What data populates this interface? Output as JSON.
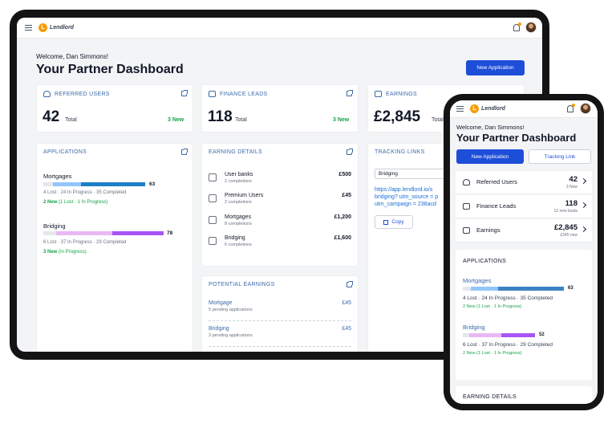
{
  "brand": {
    "name": "Lendlord",
    "logo_letter": "L"
  },
  "colors": {
    "accent": "#1d4ed8",
    "link": "#3b6aa8",
    "green": "#16a34a",
    "logo": "#f59e0b",
    "bar_light": "#93c5fd",
    "bar_dark": "#1e7fc6",
    "bar_purple_light": "#e9b8f5",
    "bar_purple_dark": "#a855f7"
  },
  "header": {
    "welcome": "Welcome, Dan Simmons!",
    "title": "Your Partner Dashboard",
    "new_application": "New Application",
    "tracking_link": "Tracking Link"
  },
  "stats": {
    "referred": {
      "title": "REFERRED USERS",
      "value": "42",
      "unit": "Total",
      "new": "3 New",
      "icon": "user-icon"
    },
    "finance": {
      "title": "FINANCE LEADS",
      "value": "118",
      "unit": "Total",
      "new": "3 New",
      "icon": "car-icon"
    },
    "earnings": {
      "title": "EARNINGS",
      "value": "£2,845",
      "unit": "Total",
      "icon": "money-icon"
    }
  },
  "applications": {
    "title": "APPLICATIONS",
    "items": [
      {
        "name": "Mortgages",
        "value": "63",
        "stats": "4 Lost · 24 In Progress · 35 Completed",
        "new": "2 New",
        "new_detail": " (1 Lost · 1 In Progress)",
        "lost": 4,
        "in_progress": 24,
        "completed": 35
      },
      {
        "name": "Bridging",
        "value": "78",
        "stats": "6 Lost · 37 In Progress · 29 Completed",
        "new": "3 New",
        "new_detail": " (In Progress)",
        "lost": 6,
        "in_progress": 37,
        "completed": 29
      }
    ]
  },
  "earning_details": {
    "title": "EARNING DETAILS",
    "items": [
      {
        "name": "User banks",
        "sub": "2 completions",
        "amount": "£500",
        "icon": "bank-icon"
      },
      {
        "name": "Premium Users",
        "sub": "2 completions",
        "amount": "£45",
        "icon": "premium-icon"
      },
      {
        "name": "Mortgages",
        "sub": "8 completions",
        "amount": "£1,200",
        "icon": "house-icon"
      },
      {
        "name": "Bridging",
        "sub": "6 completions",
        "amount": "£1,600",
        "icon": "bridge-icon"
      }
    ]
  },
  "potential_earnings": {
    "title": "POTENTIAL EARNINGS",
    "items": [
      {
        "name": "Mortgage",
        "sub": "5 pending applications",
        "amount": "£45"
      },
      {
        "name": "Bridging",
        "sub": "3 pending applications",
        "amount": "£45"
      }
    ]
  },
  "tracking": {
    "title": "TRACKING LINKS",
    "selected": "Bridging",
    "link": "https://app.lendlord.io/signup?utm_medium=referral&utm_source=bridging? utm_source=partner& utm_campaign = 238acd",
    "link_line1": "https://app.lendlord.io/s",
    "link_line2": "bridging? utm_source = p",
    "link_line3": "utm_campaign = 238acd",
    "copy": "Copy"
  },
  "phone": {
    "welcome": "Welcome, Dan Simmons!",
    "title": "Your Partner Dashboard",
    "rows": [
      {
        "label": "Referred Users",
        "value": "42",
        "sub": "3 New",
        "icon": "user-icon"
      },
      {
        "label": "Finance Leads",
        "value": "118",
        "sub": "12 new leads",
        "icon": "chart-icon"
      },
      {
        "label": "Earnings",
        "value": "£2,845",
        "sub": "£345 new",
        "icon": "money-icon"
      }
    ],
    "applications_title": "APPLICATIONS",
    "apps": [
      {
        "name": "Mortgages",
        "value": "63",
        "stats": "4 Lost · 24 In Progress · 35 Completed",
        "new": "2 New (1 Lost · 1 In Progress)"
      },
      {
        "name": "Bridging",
        "value": "52",
        "stats": "6 Lost · 37 In Progress · 29 Completed",
        "new": "2 New (1 Lost · 1 In Progress)"
      }
    ],
    "earning_details_title": "EARNING DETAILS"
  }
}
